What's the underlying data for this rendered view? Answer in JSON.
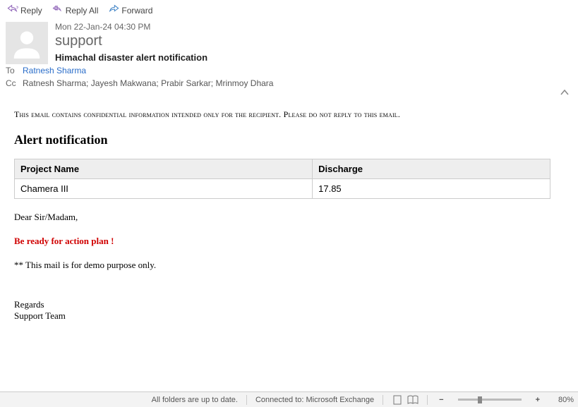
{
  "toolbar": {
    "reply": "Reply",
    "reply_all": "Reply All",
    "forward": "Forward"
  },
  "header": {
    "timestamp": "Mon 22-Jan-24 04:30 PM",
    "sender": "support",
    "subject": "Himachal disaster alert notification"
  },
  "recipients": {
    "to_label": "To",
    "to": "Ratnesh Sharma",
    "cc_label": "Cc",
    "cc": "Ratnesh Sharma; Jayesh Makwana; Prabir Sarkar; Mrinmoy Dhara"
  },
  "body": {
    "confidential": "This email contains confidential information intended only for the recipient. Please do not reply to this email.",
    "heading": "Alert notification",
    "table": {
      "col1": "Project Name",
      "col2": "Discharge",
      "row1_col1": "Chamera III",
      "row1_col2": "17.85"
    },
    "salutation": "Dear Sir/Madam,",
    "action": "Be ready for action plan !",
    "demo": "** This mail is for demo purpose only.",
    "regards": "Regards",
    "team": "Support Team"
  },
  "statusbar": {
    "folders": "All folders are up to date.",
    "connection": "Connected to: Microsoft Exchange",
    "zoom_minus": "−",
    "zoom_plus": "+",
    "zoom_pct": "80%"
  }
}
